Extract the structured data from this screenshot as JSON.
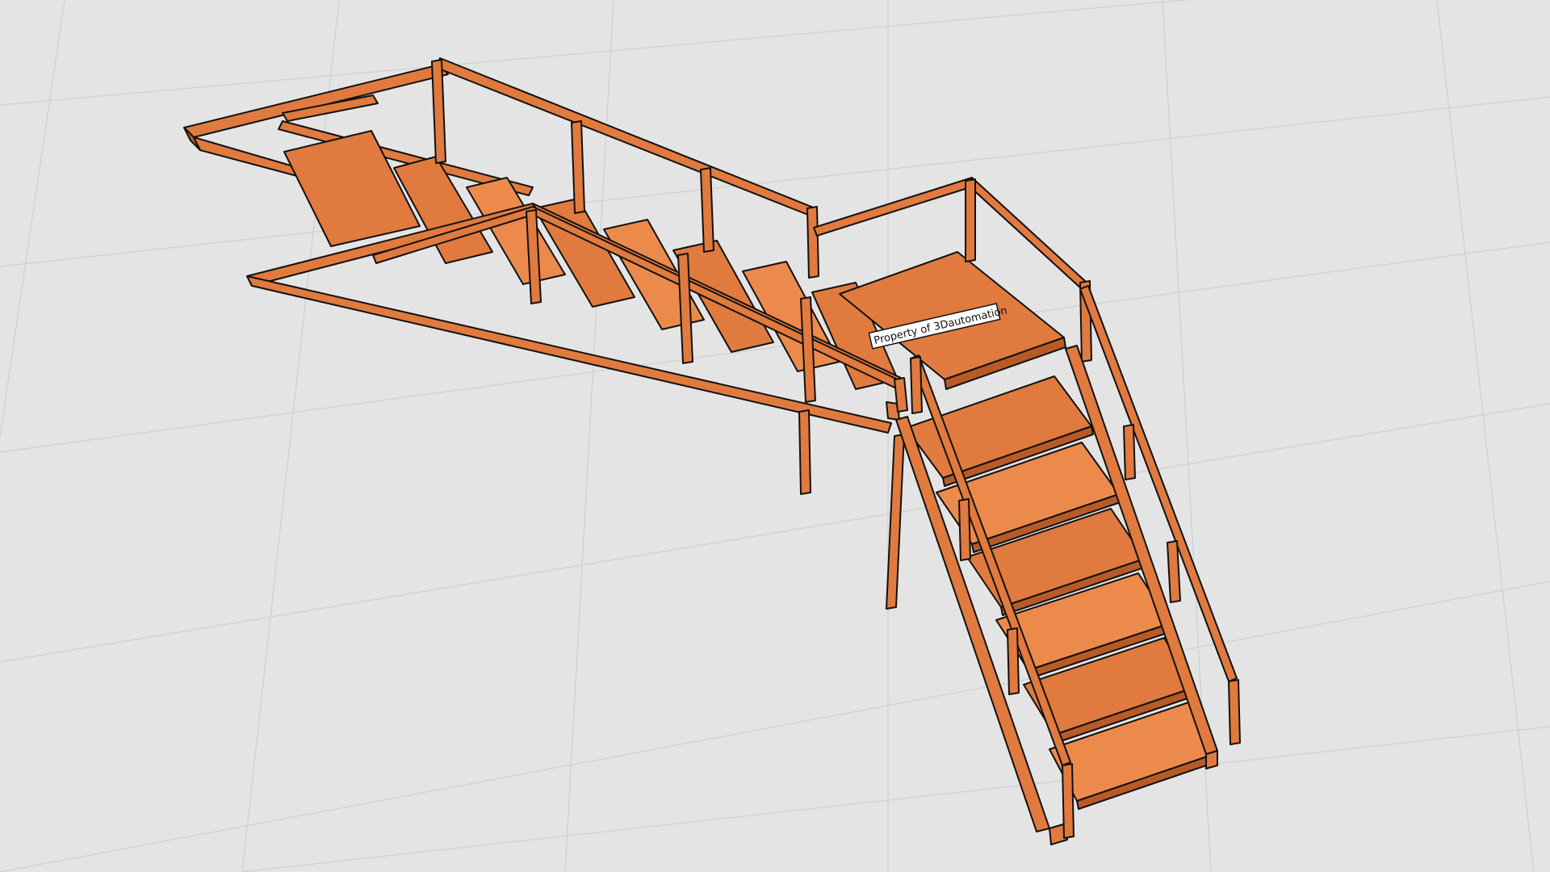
{
  "scene": {
    "watermark_label": "Property of 3Dautomation",
    "colors": {
      "background": "#e4e4e4",
      "grid_line": "#cfcfcf",
      "steel": "#e07a3e",
      "steel_light": "#ec8a4c",
      "steel_dark": "#b85a28",
      "outline": "#111111",
      "label_bg": "#ffffff"
    }
  }
}
